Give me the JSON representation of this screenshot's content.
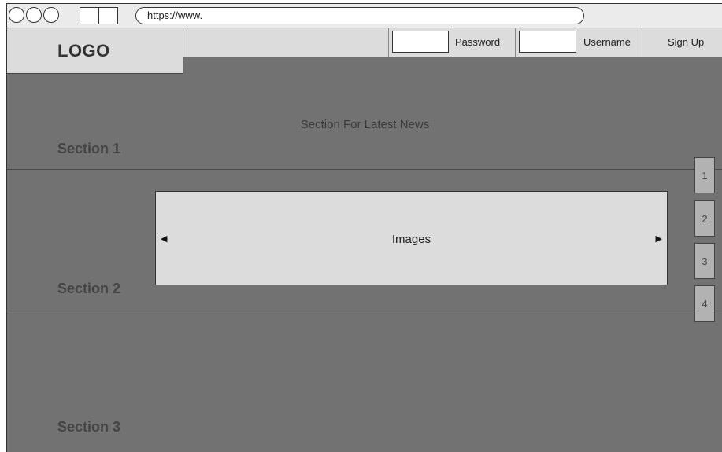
{
  "browser": {
    "url": "https://www."
  },
  "header": {
    "logo": "LOGO",
    "password_label": "Password",
    "username_label": "Username",
    "signup_label": "Sign Up"
  },
  "sections": {
    "section1": {
      "label": "Section 1",
      "content": "Section For Latest News"
    },
    "section2": {
      "label": "Section 2",
      "carousel_text": "Images",
      "prev_arrow": "◀",
      "next_arrow": "▶"
    },
    "section3": {
      "label": "Section 3"
    }
  },
  "pagination": [
    "1",
    "2",
    "3",
    "4"
  ],
  "colors": {
    "page_bg": "#727272",
    "panel_bg": "#dcdcdc",
    "pager_bg": "#b2b2b2"
  }
}
